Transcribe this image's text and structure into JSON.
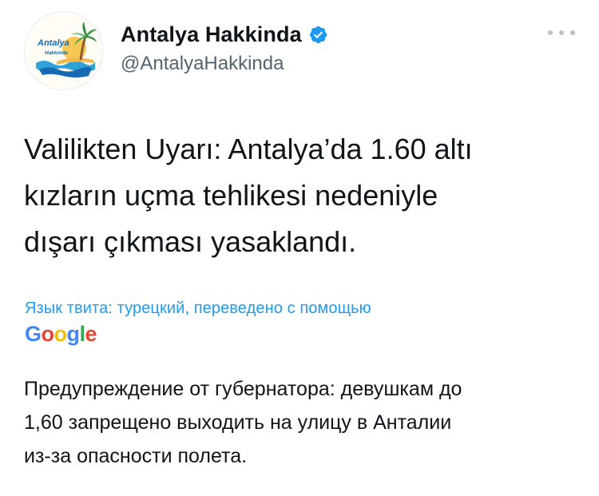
{
  "tweet": {
    "author": {
      "display_name": "Antalya Hakkinda",
      "handle": "@AntalyaHakkinda",
      "verified": true,
      "avatar_logo_line1": "Antalya",
      "avatar_logo_line2": "Hakkında"
    },
    "text": "Valilikten Uyarı: Antalya’da 1.60 altı\nkızların uçma tehlikesi nedeniyle\ndışarı çıkması yasaklandı.",
    "translation_label": "Язык твита: турецкий, переведено с помощью",
    "translation_provider": {
      "letters": [
        "G",
        "o",
        "o",
        "g",
        "l",
        "e"
      ]
    },
    "translated_text": "Предупреждение от губернатора: девушкам до\n1,60 запрещено выходить на улицу в Анталии\nиз-за опасности полета."
  },
  "colors": {
    "text_primary": "#0f1419",
    "text_secondary": "#536471",
    "accent": "#1d9bf0",
    "background": "#ffffff"
  },
  "icons": {
    "verified": "verified-badge-icon",
    "more": "more-options-icon"
  }
}
